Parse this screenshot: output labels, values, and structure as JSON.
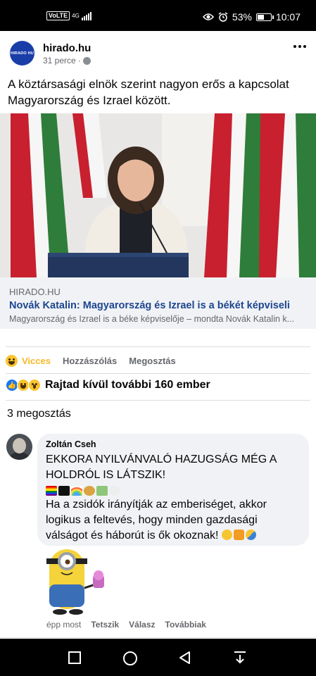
{
  "status_bar": {
    "volte": "VoLTE",
    "network": "4G",
    "battery": "53%",
    "battery_level": 0.53,
    "time": "10:07"
  },
  "post": {
    "page_name": "hirado.hu",
    "avatar_text": "HIRADO HU",
    "time": "31 perce",
    "time_sep": "·",
    "text": "A köztársasági elnök szerint nagyon erős a kapcsolat Magyarország és Izrael között.",
    "link": {
      "domain": "HIRADO.HU",
      "title": "Novák Katalin: Magyarország és Izrael is a békét képviseli",
      "description": "Magyarország és Izrael is a béke képviselője – mondta Novák Katalin k..."
    }
  },
  "actions": {
    "reaction_label": "Vicces",
    "comment_label": "Hozzászólás",
    "share_label": "Megosztás"
  },
  "reactions_summary": {
    "text": "Rajtad kívül további 160 ember",
    "like_glyph": "👍"
  },
  "shares_text": "3 megosztás",
  "comment": {
    "author": "Zoltán Cseh",
    "line1": "EKKORA NYILVÁNVALÓ HAZUGSÁG MÉG A HOLDRÓL IS LÁTSZIK!",
    "line2": "Ha a zsidók irányítják az emberiséget, akkor logikus a feltevés, hogy minden gazdasági válságot és háborút is ők okoznak!",
    "time": "épp most",
    "like_label": "Tetszik",
    "reply_label": "Válasz",
    "more_label": "Továbbiak"
  },
  "colors": {
    "accent_blue": "#1877f2",
    "haha_yellow": "#f7b928",
    "link_title": "#1d4590",
    "bubble_bg": "#f0f2f5"
  }
}
